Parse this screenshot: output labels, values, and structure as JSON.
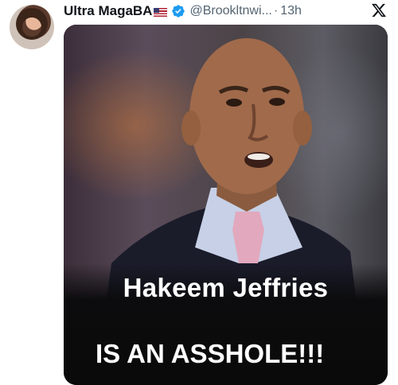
{
  "tweet": {
    "display_name": "Ultra MagaBA",
    "flag_icon": "us-flag-icon",
    "verified_icon": "verified-badge-icon",
    "handle": "@Brookltnwi...",
    "separator": "·",
    "timestamp": "13h",
    "platform_icon": "x-logo-icon",
    "media": {
      "headline": "Hakeem Jeffries",
      "subline": "IS AN ASSHOLE!!!"
    }
  },
  "colors": {
    "text_primary": "#0f1419",
    "text_secondary": "#536471",
    "verified_blue": "#1d9bf0",
    "media_background": "#131313"
  }
}
